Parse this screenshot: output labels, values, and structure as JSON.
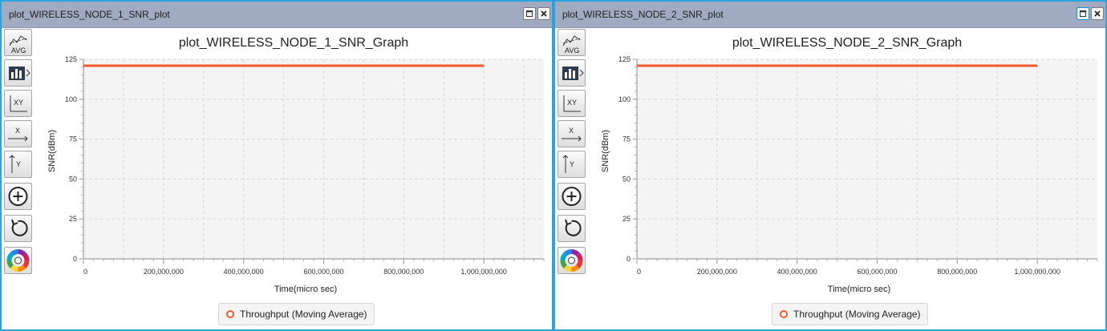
{
  "colors": {
    "accent": "#2aa4dd",
    "series": "#f15a29",
    "titlebar": "#a0abc2",
    "plot_background": "#f4f4f4"
  },
  "windows": [
    {
      "title": "plot_WIRELESS_NODE_1_SNR_plot",
      "maximize_active": false,
      "legend": "Throughput (Moving Average)"
    },
    {
      "title": "plot_WIRELESS_NODE_2_SNR_plot",
      "maximize_active": true,
      "legend": "Throughput (Moving Average)"
    }
  ],
  "toolbar": {
    "avg_label": "AVG",
    "xy_label": "XY",
    "x_label": "X",
    "y_label": "Y",
    "icons": [
      "avg-icon",
      "bar-chart-icon",
      "xy-axis-icon",
      "x-axis-icon",
      "y-axis-icon",
      "zoom-in-icon",
      "reset-icon",
      "color-wheel-icon"
    ]
  },
  "chart_data": [
    {
      "type": "line",
      "title": "plot_WIRELESS_NODE_1_SNR_Graph",
      "xlabel": "Time(micro sec)",
      "ylabel": "SNR(dBm)",
      "xlim": [
        0,
        1150000000
      ],
      "ylim": [
        0,
        125
      ],
      "xticks": [
        0,
        200000000,
        400000000,
        600000000,
        800000000,
        1000000000
      ],
      "xtick_labels": [
        "0",
        "200,000,000",
        "400,000,000",
        "600,000,000",
        "800,000,000",
        "1,000,000,000"
      ],
      "yticks": [
        0,
        25,
        50,
        75,
        100,
        125
      ],
      "ytick_labels": [
        "0",
        "25",
        "50",
        "75",
        "100",
        "125"
      ],
      "grid": true,
      "legend_position": "bottom",
      "series": [
        {
          "name": "Throughput (Moving Average)",
          "x": [
            0,
            1000000000
          ],
          "y": [
            121,
            121
          ]
        }
      ]
    },
    {
      "type": "line",
      "title": "plot_WIRELESS_NODE_2_SNR_Graph",
      "xlabel": "Time(micro sec)",
      "ylabel": "SNR(dBm)",
      "xlim": [
        0,
        1150000000
      ],
      "ylim": [
        0,
        125
      ],
      "xticks": [
        0,
        200000000,
        400000000,
        600000000,
        800000000,
        1000000000
      ],
      "xtick_labels": [
        "0",
        "200,000,000",
        "400,000,000",
        "600,000,000",
        "800,000,000",
        "1,000,000,000"
      ],
      "yticks": [
        0,
        25,
        50,
        75,
        100,
        125
      ],
      "ytick_labels": [
        "0",
        "25",
        "50",
        "75",
        "100",
        "125"
      ],
      "grid": true,
      "legend_position": "bottom",
      "series": [
        {
          "name": "Throughput (Moving Average)",
          "x": [
            0,
            1000000000
          ],
          "y": [
            121,
            121
          ]
        }
      ]
    }
  ]
}
